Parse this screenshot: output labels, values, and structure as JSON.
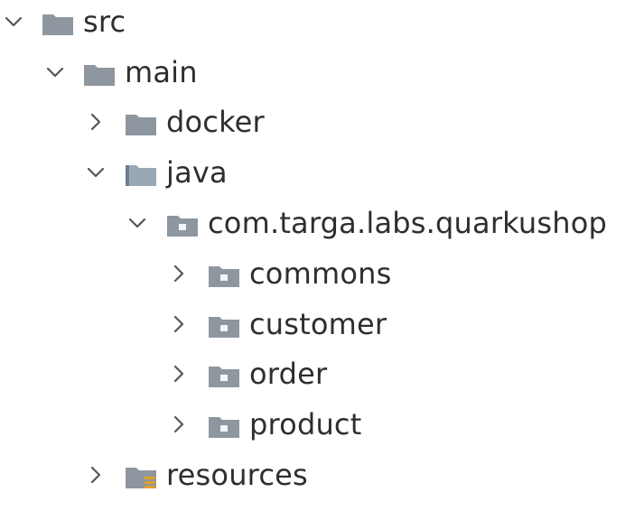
{
  "tree": {
    "nodes": [
      {
        "label": "src",
        "expanded": true,
        "icon": "folder-icon"
      },
      {
        "label": "main",
        "expanded": true,
        "icon": "folder-icon"
      },
      {
        "label": "docker",
        "expanded": false,
        "icon": "folder-icon"
      },
      {
        "label": "java",
        "expanded": true,
        "icon": "source-folder-icon"
      },
      {
        "label": "com.targa.labs.quarkushop",
        "expanded": true,
        "icon": "package-icon"
      },
      {
        "label": "commons",
        "expanded": false,
        "icon": "package-icon"
      },
      {
        "label": "customer",
        "expanded": false,
        "icon": "package-icon"
      },
      {
        "label": "order",
        "expanded": false,
        "icon": "package-icon"
      },
      {
        "label": "product",
        "expanded": false,
        "icon": "package-icon"
      },
      {
        "label": "resources",
        "expanded": false,
        "icon": "resources-folder-icon"
      }
    ]
  },
  "colors": {
    "folder": "#8e979f",
    "source_folder": "#9aa8b6",
    "chevron": "#555555",
    "resources_accent": "#e0a030"
  }
}
